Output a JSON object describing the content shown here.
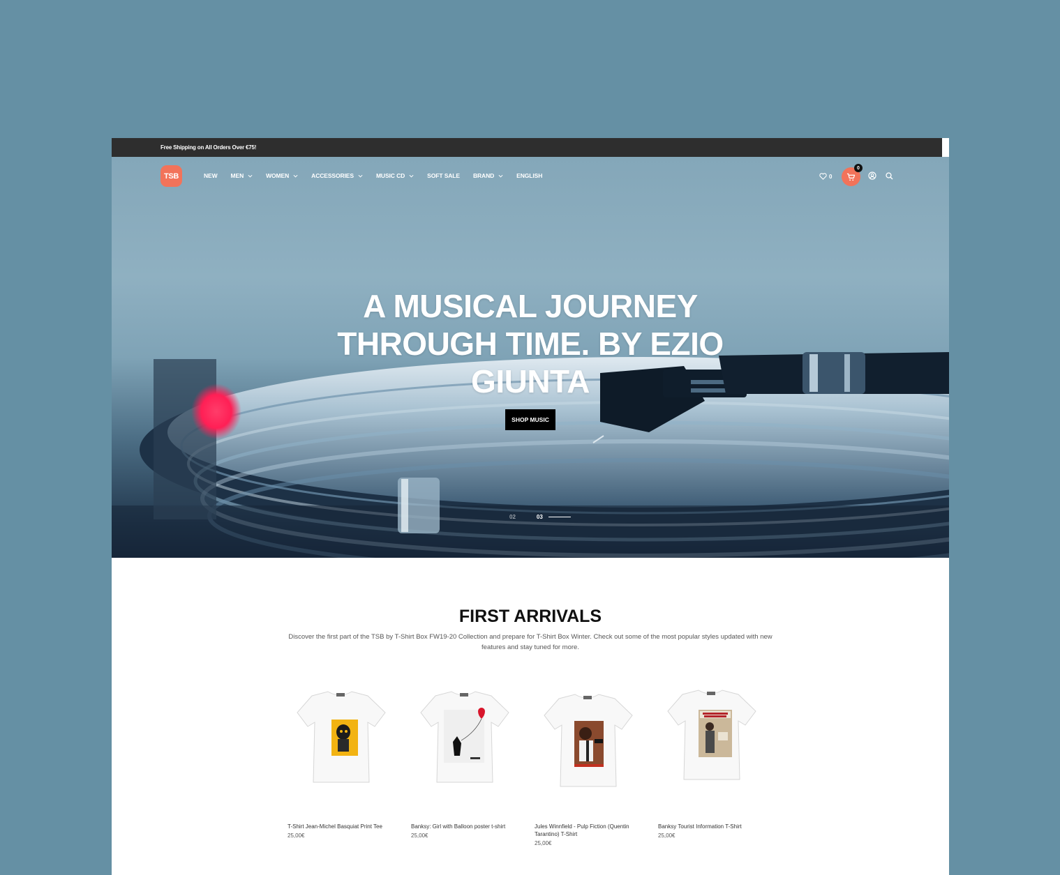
{
  "topbar": {
    "message": "Free Shipping on All Orders Over €75!"
  },
  "nav": {
    "logo": "TSB",
    "items": [
      {
        "label": "NEW",
        "has_dropdown": false
      },
      {
        "label": "MEN",
        "has_dropdown": true
      },
      {
        "label": "WOMEN",
        "has_dropdown": true
      },
      {
        "label": "ACCESSORIES",
        "has_dropdown": true
      },
      {
        "label": "MUSIC CD",
        "has_dropdown": true
      },
      {
        "label": "SOFT SALE",
        "has_dropdown": false
      },
      {
        "label": "BRAND",
        "has_dropdown": true
      },
      {
        "label": "ENGLISH",
        "has_dropdown": false
      }
    ],
    "wishlist_count": "0",
    "cart_count": "0",
    "accent": "#f2735a"
  },
  "hero": {
    "headline": "A MUSICAL JOURNEY THROUGH TIME. BY EZIO GIUNTA",
    "cta": "SHOP MUSIC",
    "slides": [
      "02",
      "03"
    ],
    "active_slide": "03"
  },
  "arrivals": {
    "title": "FIRST ARRIVALS",
    "description": "Discover the first part of the TSB by T-Shirt Box FW19-20 Collection and prepare for T-Shirt Box Winter. Check out some of the most popular styles updated with new features and stay tuned for more.",
    "products": [
      {
        "name": "T-Shirt Jean-Michel Basquiat Print Tee",
        "price": "25,00€"
      },
      {
        "name": "Banksy: Girl with Balloon poster t-shirt",
        "price": "25,00€"
      },
      {
        "name": "Jules Winnfield - Pulp Fiction (Quentin Tarantino) T-Shirt",
        "price": "25,00€"
      },
      {
        "name": "Banksy Tourist Information T-Shirt",
        "price": "25,00€"
      }
    ]
  }
}
